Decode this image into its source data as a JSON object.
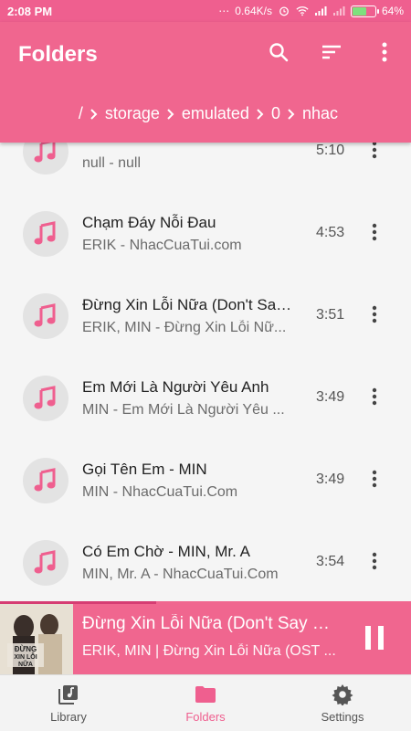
{
  "status_bar": {
    "time": "2:08 PM",
    "speed": "0.64K/s",
    "battery": "64%",
    "battery_level": 0.64
  },
  "app_bar": {
    "title": "Folders",
    "actions": [
      "search-icon",
      "sort-icon",
      "more-vert-icon"
    ],
    "breadcrumb": {
      "root": "/",
      "parts": [
        "storage",
        "emulated",
        "0",
        "nhac"
      ]
    },
    "color": "#f0668f"
  },
  "songs": [
    {
      "title": "",
      "subtitle": "null - null",
      "duration": "5:10"
    },
    {
      "title": "Chạm Đáy Nỗi Đau",
      "subtitle": "ERIK - NhacCuaTui.com",
      "duration": "4:53"
    },
    {
      "title": "Đừng Xin Lỗi Nữa (Don't Say ...",
      "subtitle": "ERIK, MIN - Đừng Xin Lỗi Nữ...",
      "duration": "3:51"
    },
    {
      "title": "Em Mới Là Người Yêu Anh",
      "subtitle": "MIN - Em Mới Là Người Yêu ...",
      "duration": "3:49"
    },
    {
      "title": "Gọi Tên Em - MIN",
      "subtitle": "MIN - NhacCuaTui.Com",
      "duration": "3:49"
    },
    {
      "title": "Có Em Chờ - MIN, Mr. A",
      "subtitle": "MIN, Mr. A - NhacCuaTui.Com",
      "duration": "3:54"
    }
  ],
  "player": {
    "title": "Đừng Xin Lỗi Nữa (Don't Say S...",
    "subtitle": "ERIK, MIN | Đừng Xin Lỗi Nữa (OST ...",
    "progress": 0.38,
    "cover_text": [
      "ĐỪNG",
      "XIN LỖI",
      "NỮA"
    ]
  },
  "bottom_nav": [
    {
      "label": "Library",
      "icon": "library-music-icon",
      "active": false
    },
    {
      "label": "Folders",
      "icon": "folder-icon",
      "active": true
    },
    {
      "label": "Settings",
      "icon": "gear-icon",
      "active": false
    }
  ]
}
